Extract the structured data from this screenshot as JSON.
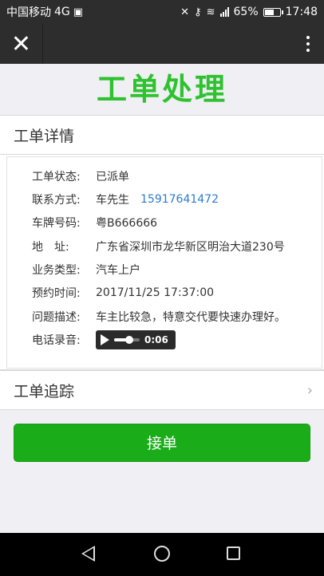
{
  "status_bar": {
    "carrier": "中国移动",
    "network": "4G",
    "battery": "65%",
    "battery_level": 0.65,
    "time": "17:48",
    "signal_label": "4G"
  },
  "page": {
    "title": "工单处理",
    "accent_color": "#2ec22e"
  },
  "details_section": {
    "header": "工单详情",
    "rows": [
      {
        "label": "工单状态:",
        "value": "已派单"
      },
      {
        "label": "联系方式:",
        "value": "车先生",
        "phone": "15917641472"
      },
      {
        "label": "车牌号码:",
        "value": "粤B666666"
      },
      {
        "label": "地　址:",
        "value": "广东省深圳市龙华新区明治大道230号"
      },
      {
        "label": "业务类型:",
        "value": "汽车上户"
      },
      {
        "label": "预约时间:",
        "value": "2017/11/25 17:37:00"
      },
      {
        "label": "问题描述:",
        "value": "车主比较急，特意交代要快速办理好。"
      },
      {
        "label": "电话录音:"
      }
    ],
    "audio": {
      "duration": "0:06",
      "progress": 0.6
    }
  },
  "tracking_section": {
    "header": "工单追踪"
  },
  "accept_button": {
    "label": "接单",
    "color": "#1aad19"
  },
  "icons": [
    "close-icon",
    "more-icon",
    "chevron-right-icon",
    "play-icon",
    "back-icon",
    "home-icon",
    "recent-apps-icon"
  ]
}
